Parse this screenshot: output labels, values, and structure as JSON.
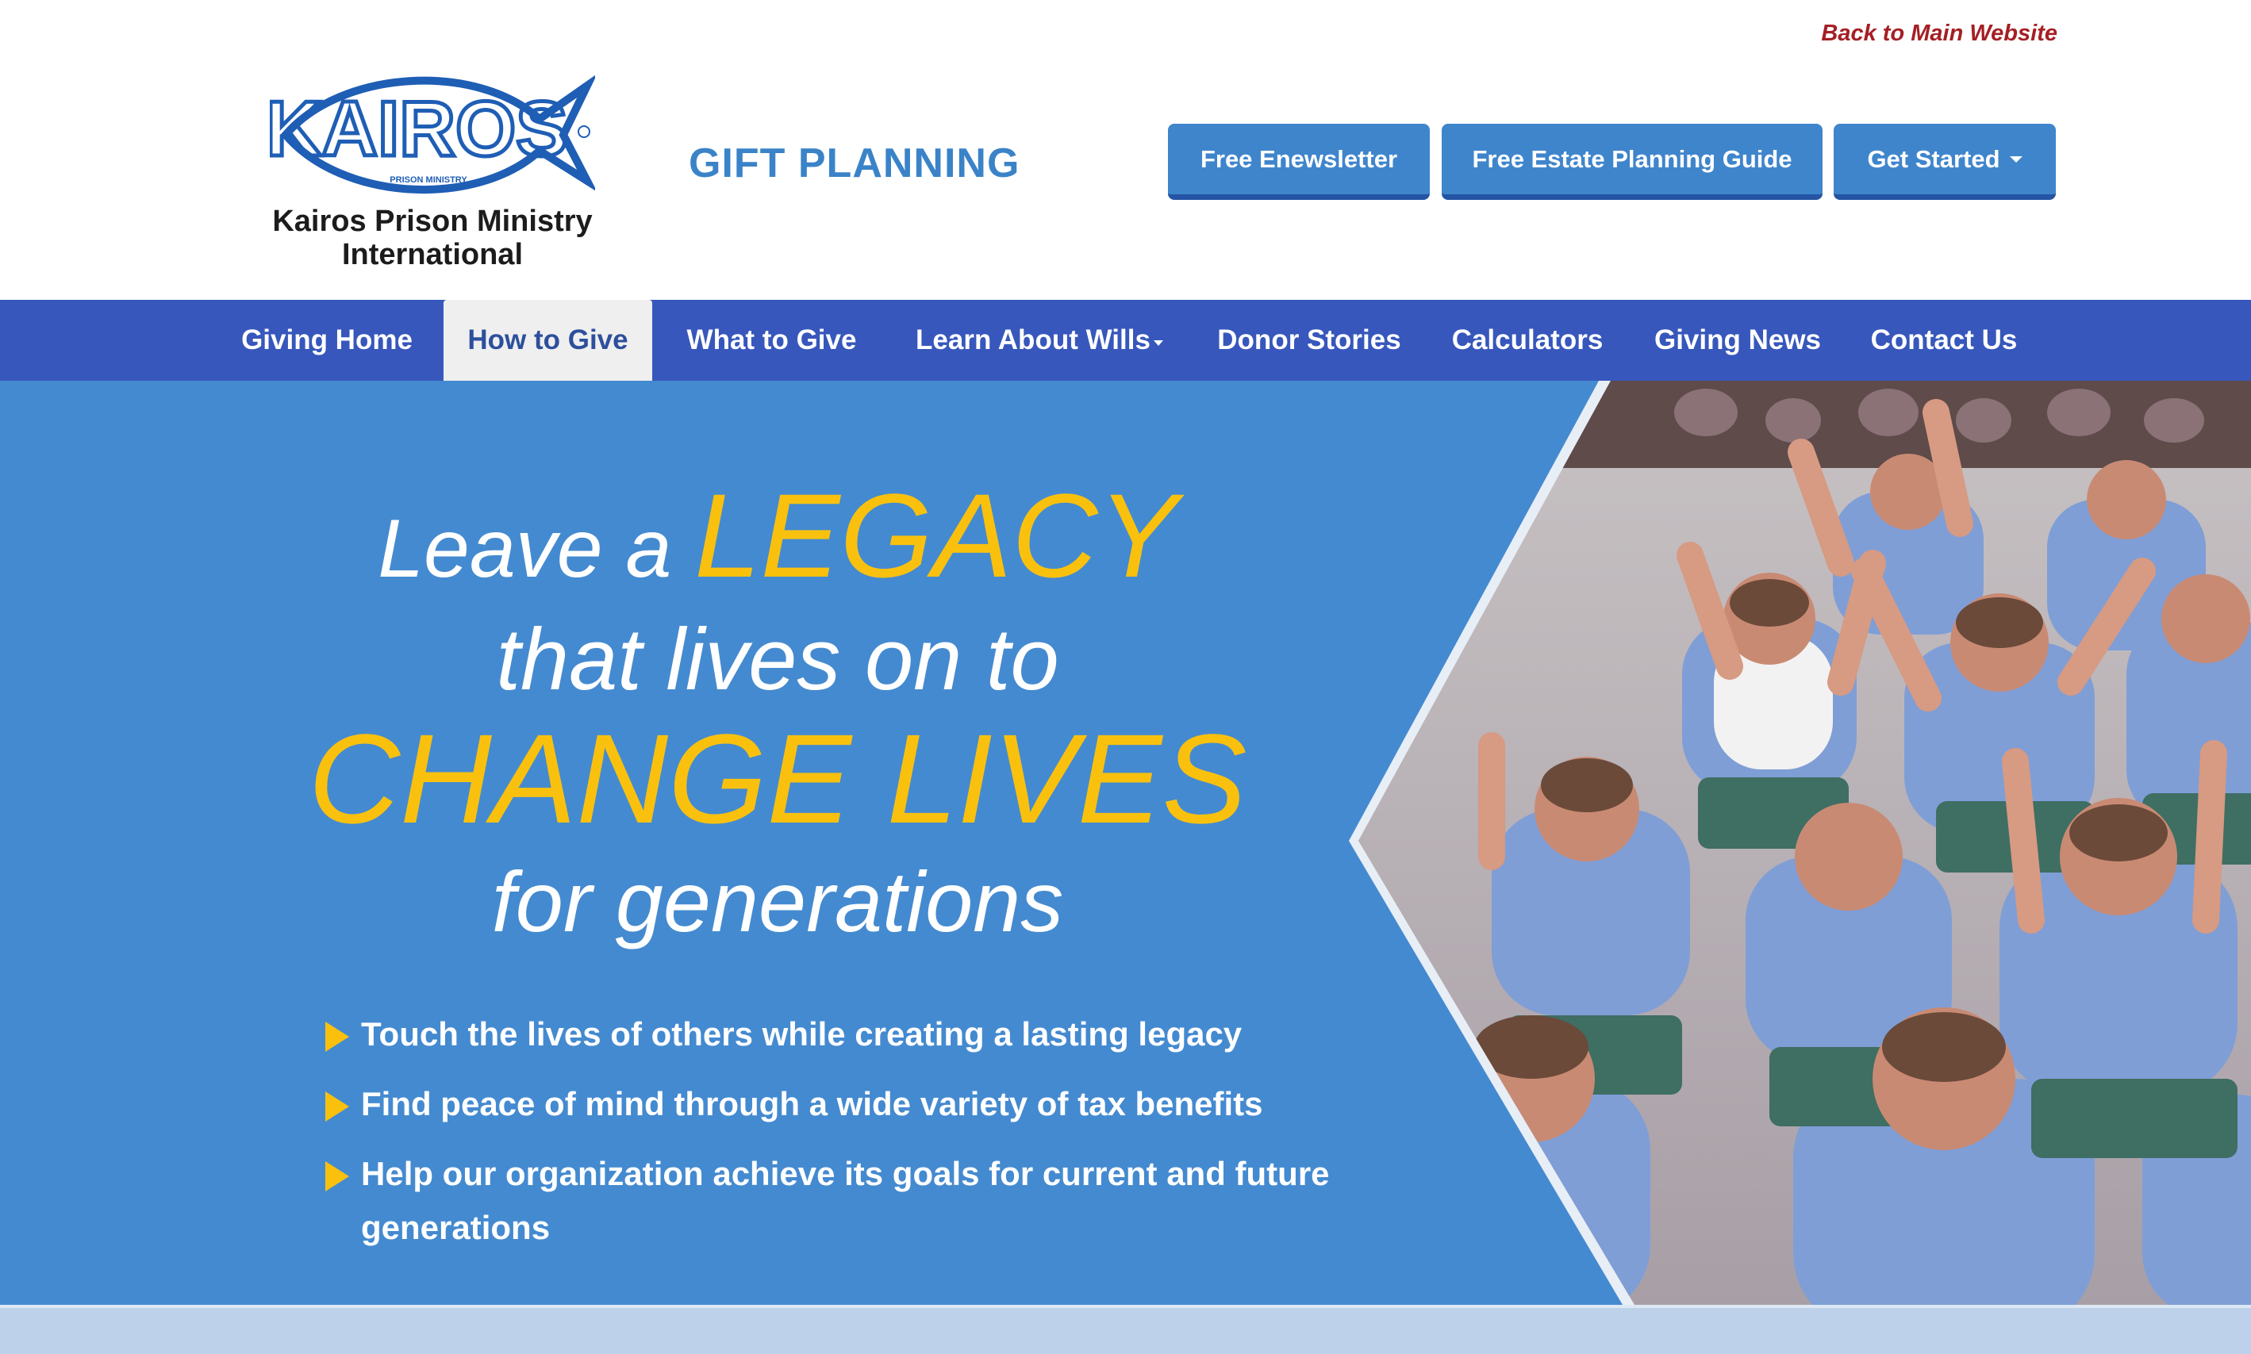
{
  "header": {
    "back_link": "Back to Main Website",
    "org_name_line1": "Kairos Prison Ministry",
    "org_name_line2": "International",
    "logo_text": "KAIROS",
    "logo_subtext": "PRISON MINISTRY",
    "section_title": "GIFT PLANNING",
    "buttons": {
      "newsletter": "Free Enewsletter",
      "guide": "Free Estate Planning Guide",
      "started": "Get Started"
    }
  },
  "nav": {
    "items": [
      "Giving Home",
      "How to Give",
      "What to Give",
      "Learn About Wills",
      "Donor Stories",
      "Calculators",
      "Giving News",
      "Contact Us"
    ],
    "active": "How to Give"
  },
  "hero": {
    "line1_pre": "Leave a",
    "line1_highlight": "LEGACY",
    "line2": "that lives on to",
    "line3": "CHANGE LIVES",
    "line4": "for generations",
    "bullets": [
      "Touch the lives of others while creating a lasting legacy",
      "Find peace of mind through a wide variety of tax benefits",
      "Help our organization achieve its goals for current and future generations"
    ]
  },
  "colors": {
    "nav_bg": "#3757bc",
    "hero_bg": "#448ad0",
    "gold": "#f9c10e",
    "button": "#3f85cc",
    "link_red": "#a51f24"
  }
}
